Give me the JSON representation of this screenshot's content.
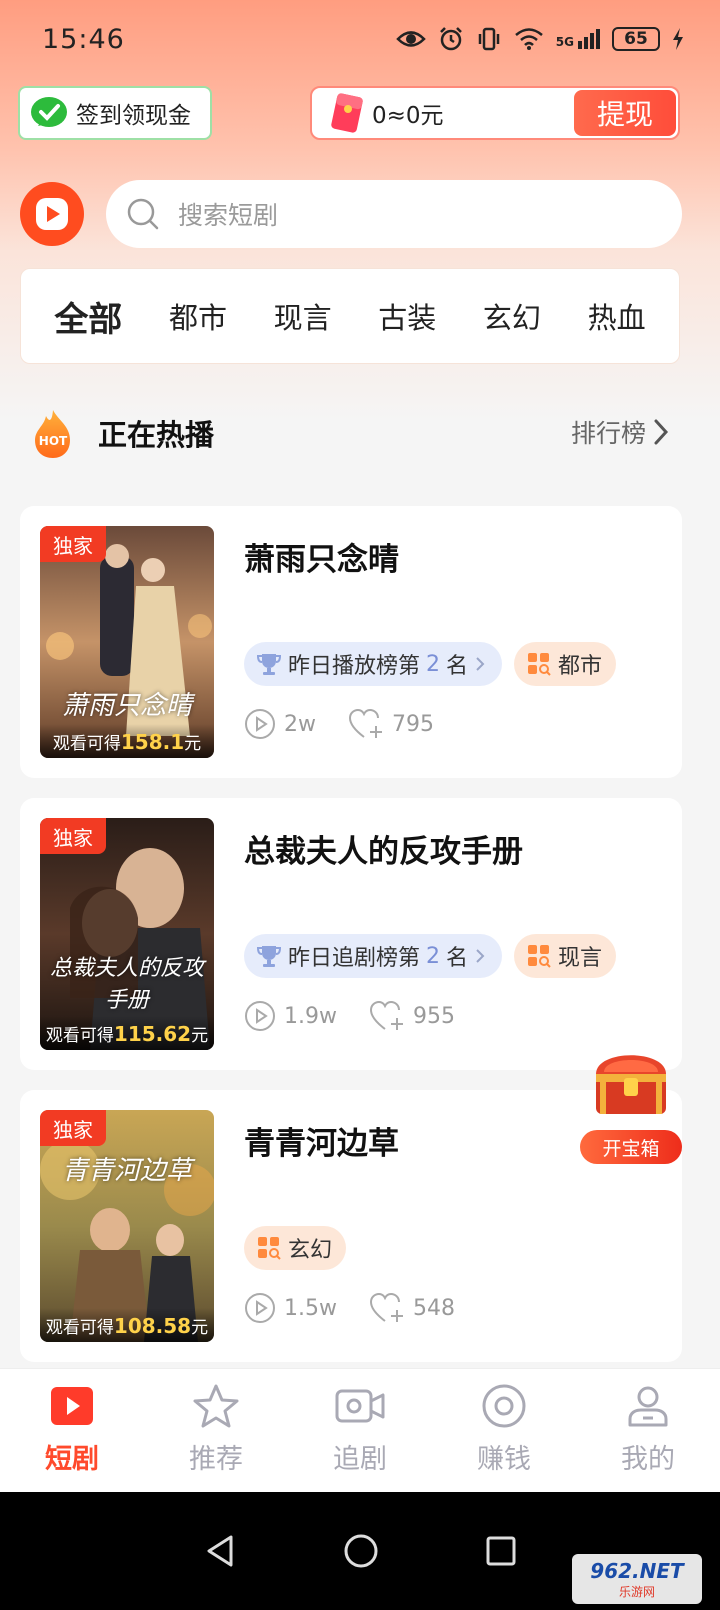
{
  "status_bar": {
    "time": "15:46",
    "network": "5G",
    "battery": "65",
    "icons": [
      "eye-icon",
      "alarm-icon",
      "vibrate-icon",
      "wifi-icon",
      "signal-icon",
      "battery-icon",
      "charging-icon"
    ]
  },
  "header": {
    "checkin_label": "签到领现金",
    "wallet_balance": "0≈0元",
    "withdraw_label": "提现"
  },
  "search": {
    "placeholder": "搜索短剧"
  },
  "categories": [
    {
      "label": "全部",
      "active": true
    },
    {
      "label": "都市",
      "active": false
    },
    {
      "label": "现言",
      "active": false
    },
    {
      "label": "古装",
      "active": false
    },
    {
      "label": "玄幻",
      "active": false
    },
    {
      "label": "热血",
      "active": false
    }
  ],
  "section": {
    "hot_badge": "HOT",
    "title": "正在热播",
    "ranking_label": "排行榜"
  },
  "dramas": [
    {
      "badge": "独家",
      "title": "萧雨只念晴",
      "poster_text": "萧雨只念晴",
      "reward_prefix": "观看可得",
      "reward_amount": "158.1",
      "reward_unit": "元",
      "rank_text": "昨日播放榜第",
      "rank_num": "2",
      "rank_unit": "名",
      "genre": "都市",
      "plays": "2w",
      "likes": "795"
    },
    {
      "badge": "独家",
      "title": "总裁夫人的反攻手册",
      "poster_text": "总裁夫人的反攻手册",
      "reward_prefix": "观看可得",
      "reward_amount": "115.62",
      "reward_unit": "元",
      "rank_text": "昨日追剧榜第",
      "rank_num": "2",
      "rank_unit": "名",
      "genre": "现言",
      "plays": "1.9w",
      "likes": "955"
    },
    {
      "badge": "独家",
      "title": "青青河边草",
      "poster_text": "青青河边草",
      "reward_prefix": "观看可得",
      "reward_amount": "108.58",
      "reward_unit": "元",
      "genre": "玄幻",
      "plays": "1.5w",
      "likes": "548"
    }
  ],
  "treasure": {
    "label": "开宝箱"
  },
  "bottom_nav": [
    {
      "label": "短剧",
      "icon": "play-square-icon",
      "active": true
    },
    {
      "label": "推荐",
      "icon": "star-icon",
      "active": false
    },
    {
      "label": "追剧",
      "icon": "video-camera-icon",
      "active": false
    },
    {
      "label": "赚钱",
      "icon": "coin-icon",
      "active": false
    },
    {
      "label": "我的",
      "icon": "user-icon",
      "active": false
    }
  ],
  "watermark": {
    "top": "962.NET",
    "bottom": "乐游网"
  },
  "colors": {
    "accent": "#ff4a2c",
    "brand_logo": "#ff4c1f",
    "reward_gold": "#ffd24a",
    "wechat_green": "#2dbb3c"
  }
}
